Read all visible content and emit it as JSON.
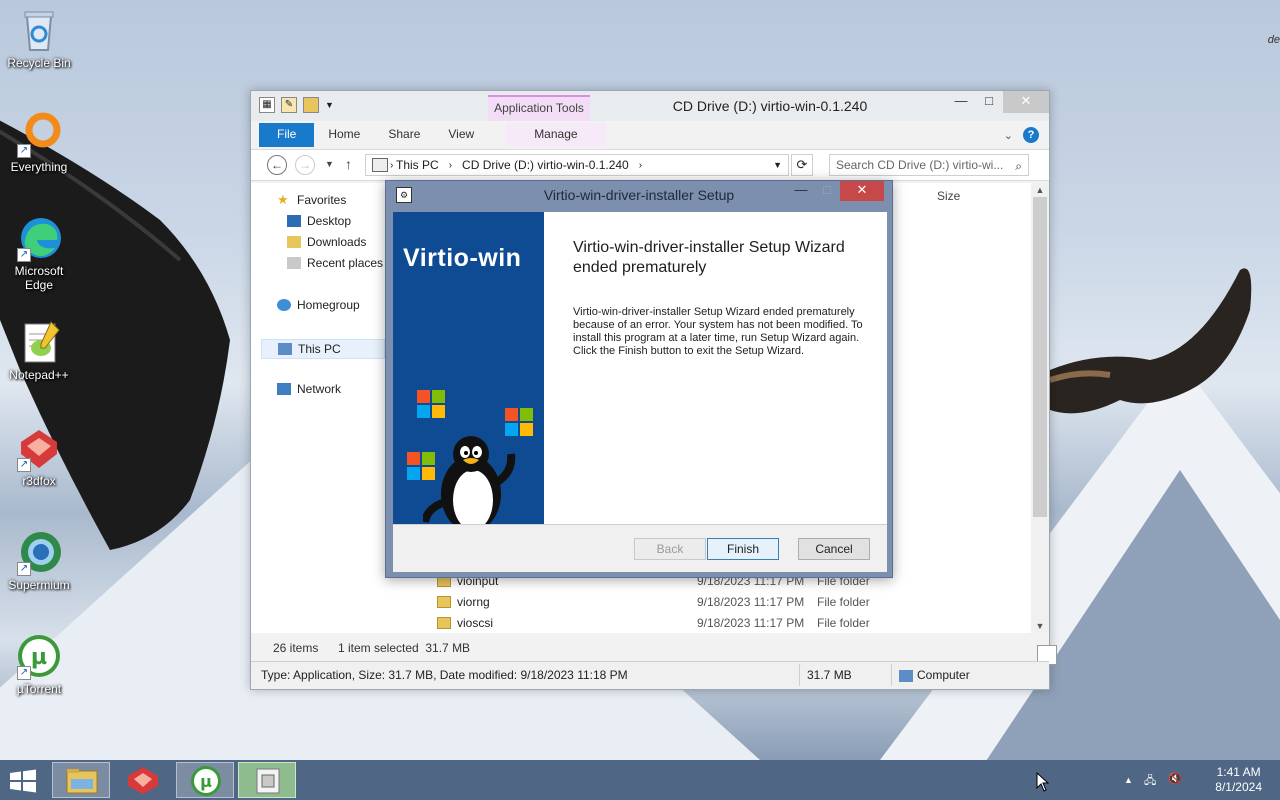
{
  "desktop": {
    "corner_text": "de",
    "icons": [
      {
        "label": "Recycle Bin",
        "icon": "recycle-bin-icon"
      },
      {
        "label": "Everything",
        "icon": "everything-icon"
      },
      {
        "label": "Microsoft Edge",
        "icon": "edge-icon"
      },
      {
        "label": "Notepad++",
        "icon": "notepadpp-icon"
      },
      {
        "label": "r3dfox",
        "icon": "r3dfox-icon"
      },
      {
        "label": "Supermium",
        "icon": "supermium-icon"
      },
      {
        "label": "µTorrent",
        "icon": "utorrent-icon"
      }
    ]
  },
  "explorer": {
    "title": "CD Drive (D:) virtio-win-0.1.240",
    "contextual_tab_group": "Application Tools",
    "ribbon_tabs": [
      "File",
      "Home",
      "Share",
      "View",
      "Manage"
    ],
    "address": {
      "segments": [
        "This PC",
        "CD Drive (D:) virtio-win-0.1.240"
      ]
    },
    "search_placeholder": "Search CD Drive (D:) virtio-wi...",
    "nav": {
      "favorites": "Favorites",
      "desktop": "Desktop",
      "downloads": "Downloads",
      "recent": "Recent places",
      "homegroup": "Homegroup",
      "thispc": "This PC",
      "network": "Network"
    },
    "column_size": "Size",
    "files": [
      {
        "name": "vioinput",
        "date": "9/18/2023 11:17 PM",
        "type": "File folder"
      },
      {
        "name": "viorng",
        "date": "9/18/2023 11:17 PM",
        "type": "File folder"
      },
      {
        "name": "vioscsi",
        "date": "9/18/2023 11:17 PM",
        "type": "File folder"
      }
    ],
    "status": {
      "items": "26 items",
      "selected": "1 item selected  31.7 MB"
    },
    "details_bar": {
      "info": "Type: Application, Size: 31.7 MB, Date modified: 9/18/2023 11:18 PM",
      "size": "31.7 MB",
      "location": "Computer"
    }
  },
  "setup": {
    "title": "Virtio-win-driver-installer Setup",
    "banner_text": "Virtio-win",
    "heading": "Virtio-win-driver-installer Setup Wizard ended prematurely",
    "message": "Virtio-win-driver-installer Setup Wizard ended prematurely because of an error. Your system has not been modified. To install this program at a later time, run Setup Wizard again. Click the Finish button to exit the Setup Wizard.",
    "buttons": {
      "back": "Back",
      "finish": "Finish",
      "cancel": "Cancel"
    }
  },
  "taskbar": {
    "time": "1:41 AM",
    "date": "8/1/2024"
  },
  "colors": {
    "banner": "#0f4b93",
    "file_tab": "#1979ca",
    "taskbar": "#4f6684",
    "close_red": "#c74848"
  }
}
